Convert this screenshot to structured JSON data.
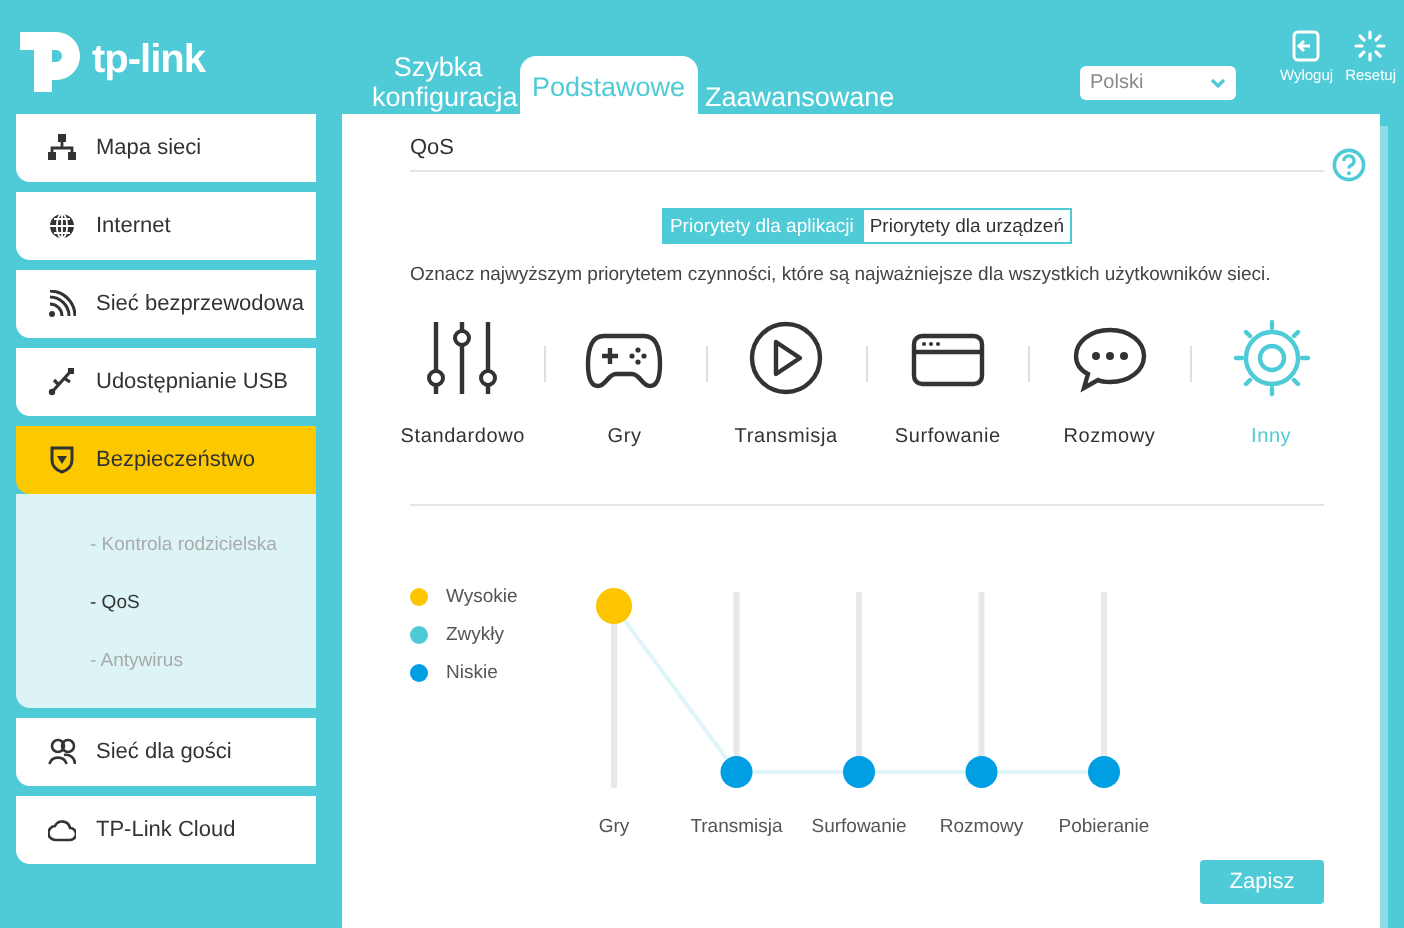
{
  "logo": {
    "text": "tp-link"
  },
  "nav_tabs": [
    {
      "label": "Szybka konfiguracja",
      "selected": false
    },
    {
      "label": "Podstawowe",
      "selected": true
    },
    {
      "label": "Zaawansowane",
      "selected": false
    }
  ],
  "language": {
    "value": "Polski"
  },
  "header_actions": [
    {
      "kind": "logout",
      "label": "Wyloguj"
    },
    {
      "kind": "reset",
      "label": "Resetuj"
    }
  ],
  "sidebar": {
    "items": [
      {
        "kind": "network-map",
        "label": "Mapa sieci",
        "selected": false
      },
      {
        "kind": "internet",
        "label": "Internet",
        "selected": false
      },
      {
        "kind": "wireless",
        "label": "Sieć bezprzewodowa",
        "selected": false
      },
      {
        "kind": "usb",
        "label": "Udostępnianie USB",
        "selected": false
      },
      {
        "kind": "security",
        "label": "Bezpieczeństwo",
        "selected": true,
        "expanded": true,
        "children": [
          {
            "label": "- Kontrola rodzicielska",
            "selected": false
          },
          {
            "label": "- QoS",
            "selected": true
          },
          {
            "label": "- Antywirus",
            "selected": false
          }
        ]
      },
      {
        "kind": "guest",
        "label": "Sieć dla gości",
        "selected": false
      },
      {
        "kind": "cloud",
        "label": "TP-Link Cloud",
        "selected": false
      }
    ]
  },
  "page": {
    "title": "QoS"
  },
  "mode_tabs": [
    {
      "label": "Priorytety dla aplikacji",
      "selected": true
    },
    {
      "label": "Priorytety dla urządzeń",
      "selected": false
    }
  ],
  "description": "Oznacz najwyższym priorytetem czynności, które są najważniejsze dla wszystkich użytkowników sieci.",
  "categories": [
    {
      "kind": "standard",
      "label": "Standardowo",
      "selected": false
    },
    {
      "kind": "gaming",
      "label": "Gry",
      "selected": false
    },
    {
      "kind": "streaming",
      "label": "Transmisja",
      "selected": false
    },
    {
      "kind": "browsing",
      "label": "Surfowanie",
      "selected": false
    },
    {
      "kind": "chat",
      "label": "Rozmowy",
      "selected": false
    },
    {
      "kind": "other",
      "label": "Inny",
      "selected": true
    }
  ],
  "legend": [
    {
      "label": "Wysokie",
      "color": "#fcc500"
    },
    {
      "label": "Zwykły",
      "color": "#4ccbd6"
    },
    {
      "label": "Niskie",
      "color": "#009fe3"
    }
  ],
  "priorities": [
    {
      "label": "Gry",
      "level": 1
    },
    {
      "label": "Transmisja",
      "level": 0
    },
    {
      "label": "Surfowanie",
      "level": 0
    },
    {
      "label": "Rozmowy",
      "level": 0
    },
    {
      "label": "Pobieranie",
      "level": 0
    }
  ],
  "save_button": {
    "label": "Zapisz"
  }
}
